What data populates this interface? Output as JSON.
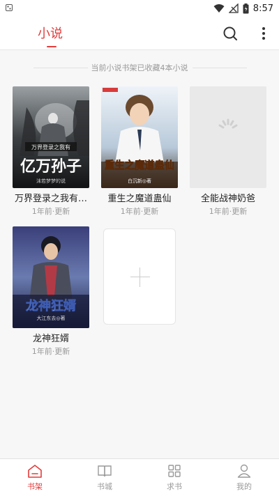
{
  "status_bar": {
    "time": "8:57",
    "icons": [
      "notification-icon",
      "wifi-icon",
      "signal-icon",
      "battery-icon"
    ]
  },
  "app_bar": {
    "title": "小说",
    "accent_color": "#e23c3c",
    "actions": [
      "search-icon",
      "more-vertical-icon"
    ]
  },
  "shelf": {
    "info_text": "当前小说书架已收藏4本小说",
    "books": [
      {
        "name": "万界登录之我有…",
        "updated": "1年前·更新",
        "cover_title": "亿万孙子",
        "cover_subtitle": "万界登录之我有",
        "cover_author": "沫若梦梦的说"
      },
      {
        "name": "重生之魔道蛊仙",
        "updated": "1年前·更新",
        "cover_title": "重生之魔道蛊仙",
        "cover_author": "白沉新◎著"
      },
      {
        "name": "全能战神奶爸",
        "updated": "1年前·更新",
        "cover_title": ""
      },
      {
        "name": "龙神狂婿",
        "updated": "1年前·更新",
        "cover_title": "龙神狂婿",
        "cover_author": "大江东去◎著"
      }
    ],
    "add_button_icon": "plus-icon"
  },
  "tab_bar": {
    "tabs": [
      {
        "label": "书架",
        "icon": "bookshelf-icon",
        "active": true
      },
      {
        "label": "书城",
        "icon": "book-open-icon",
        "active": false
      },
      {
        "label": "求书",
        "icon": "grid-icon",
        "active": false
      },
      {
        "label": "我的",
        "icon": "user-icon",
        "active": false
      }
    ]
  }
}
